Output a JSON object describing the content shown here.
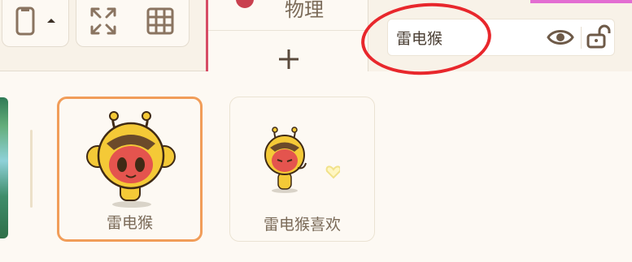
{
  "tabs": {
    "active_tab_label": "物理"
  },
  "sprite": {
    "name": "雷电猴"
  },
  "costumes": [
    {
      "label": "雷电猴"
    },
    {
      "label": "雷电猴喜欢"
    }
  ],
  "colors": {
    "selection_border": "#f19d59",
    "annotation_circle": "#e8272c",
    "accent_red": "#c9404f"
  }
}
